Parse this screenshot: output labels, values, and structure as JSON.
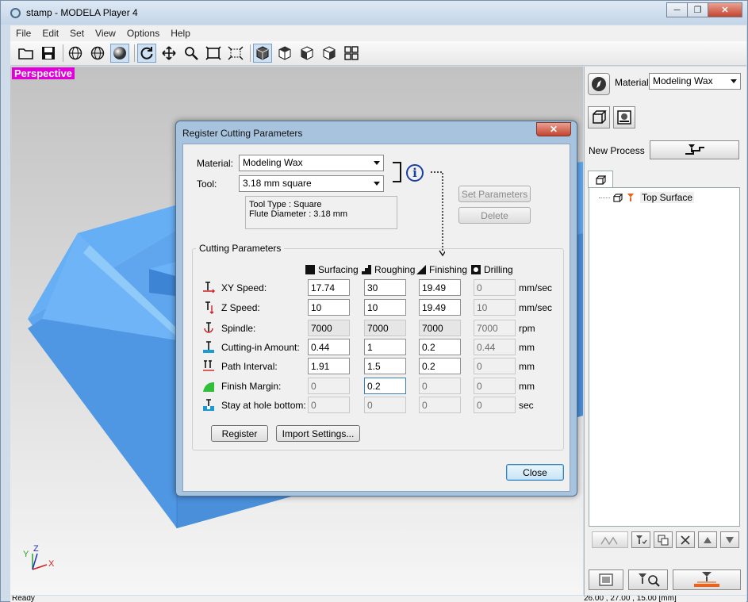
{
  "window": {
    "title": "stamp - MODELA Player 4",
    "min": "─",
    "max": "❐",
    "close": "✕"
  },
  "menu": [
    "File",
    "Edit",
    "Set",
    "View",
    "Options",
    "Help"
  ],
  "viewport": {
    "label": "Perspective",
    "axes": {
      "x": "X",
      "y": "Y",
      "z": "Z"
    }
  },
  "panel": {
    "material_label": "Material",
    "material_value": "Modeling Wax",
    "new_process_label": "New Process",
    "tree_item": "Top Surface"
  },
  "dialog": {
    "title": "Register Cutting Parameters",
    "close": "✕",
    "material_label": "Material:",
    "material_value": "Modeling Wax",
    "tool_label": "Tool:",
    "tool_value": "3.18 mm square",
    "tool_type": "Tool Type : Square",
    "flute_diameter": "Flute Diameter : 3.18 mm",
    "set_parameters": "Set Parameters",
    "delete": "Delete",
    "group_title": "Cutting Parameters",
    "columns": [
      "Surfacing",
      "Roughing",
      "Finishing",
      "Drilling"
    ],
    "rows": [
      {
        "label": "XY Speed:",
        "values": [
          "17.74",
          "30",
          "19.49",
          "0"
        ],
        "unit": "mm/sec"
      },
      {
        "label": "Z Speed:",
        "values": [
          "10",
          "10",
          "19.49",
          "10"
        ],
        "unit": "mm/sec"
      },
      {
        "label": "Spindle:",
        "values": [
          "7000",
          "7000",
          "7000",
          "7000"
        ],
        "unit": "rpm"
      },
      {
        "label": "Cutting-in Amount:",
        "values": [
          "0.44",
          "1",
          "0.2",
          "0.44"
        ],
        "unit": "mm"
      },
      {
        "label": "Path Interval:",
        "values": [
          "1.91",
          "1.5",
          "0.2",
          "0"
        ],
        "unit": "mm"
      },
      {
        "label": "Finish Margin:",
        "values": [
          "0",
          "0.2",
          "0",
          "0"
        ],
        "unit": "mm"
      },
      {
        "label": "Stay at hole bottom:",
        "values": [
          "0",
          "0",
          "0",
          "0"
        ],
        "unit": "sec"
      }
    ],
    "register": "Register",
    "import_settings": "Import Settings...",
    "close_button": "Close"
  },
  "status": {
    "left": "Ready",
    "right": "26.00 , 27.00 , 15.00 [mm]"
  }
}
